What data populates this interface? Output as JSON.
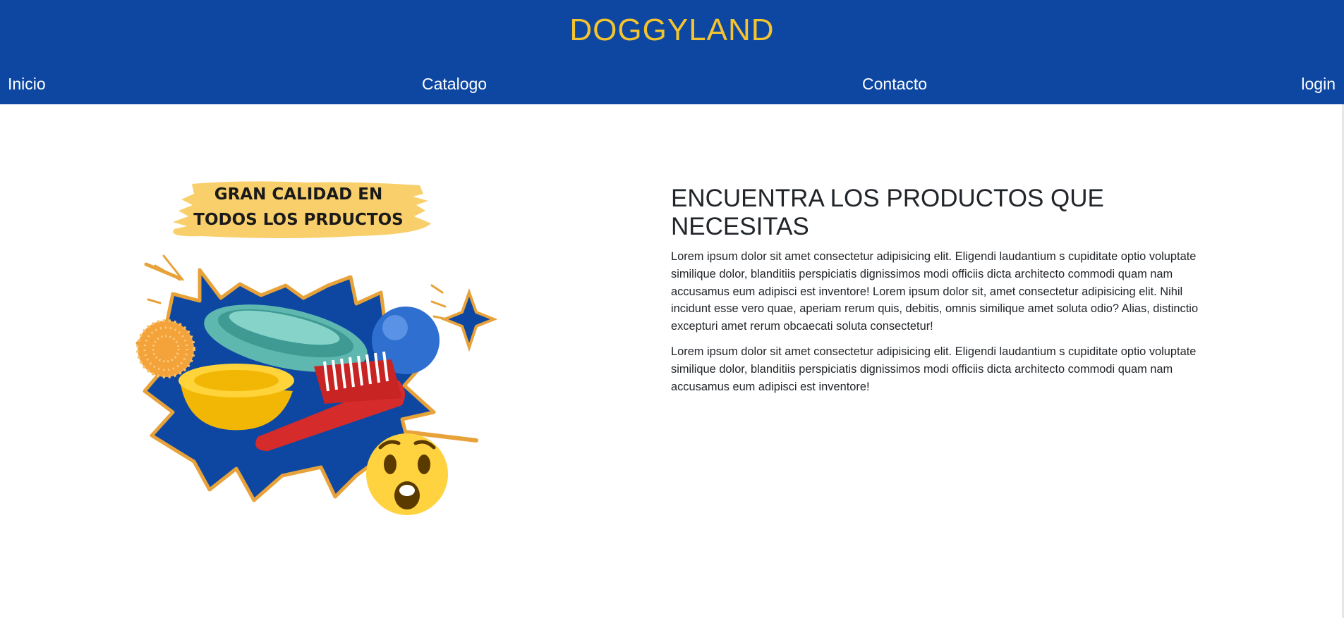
{
  "header": {
    "brand": "DOGGYLAND",
    "nav": {
      "inicio": "Inicio",
      "catalogo": "Catalogo",
      "contacto": "Contacto",
      "login": "login"
    }
  },
  "promo": {
    "banner_line1": "GRAN CALIDAD EN",
    "banner_line2": "TODOS LOS PRDUCTOS"
  },
  "content": {
    "heading": "ENCUENTRA LOS PRODUCTOS QUE NECESITAS",
    "paragraph1": "Lorem ipsum dolor sit amet consectetur adipisicing elit. Eligendi laudantium s cupiditate optio voluptate similique dolor, blanditiis perspiciatis dignissimos modi officiis dicta architecto commodi quam nam accusamus eum adipisci est inventore! Lorem ipsum dolor sit, amet consectetur adipisicing elit. Nihil incidunt esse vero quae, aperiam rerum quis, debitis, omnis similique amet soluta odio? Alias, distinctio excepturi amet rerum obcaecati soluta consectetur!",
    "paragraph2": "Lorem ipsum dolor sit amet consectetur adipisicing elit. Eligendi laudantium s cupiditate optio voluptate similique dolor, blanditiis perspiciatis dignissimos modi officiis dicta architecto commodi quam nam accusamus eum adipisci est inventore!"
  },
  "colors": {
    "header_bg": "#0d47a1",
    "brand": "#f4c430",
    "banner": "#f9cf6b",
    "burst_fill": "#0d47a1",
    "burst_outline": "#e8a23a"
  }
}
